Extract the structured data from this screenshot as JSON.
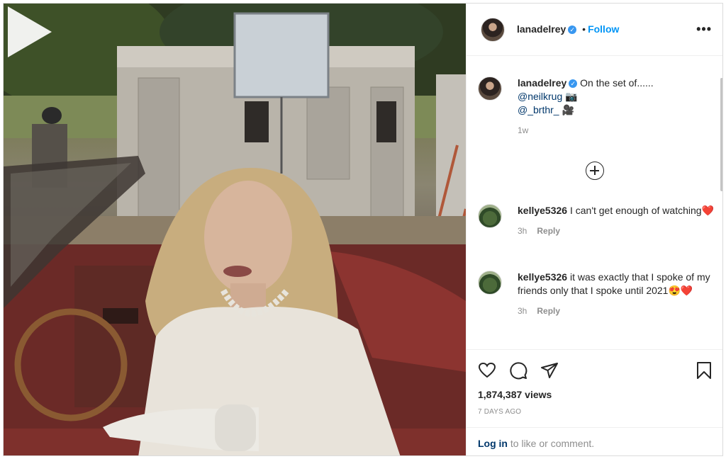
{
  "post": {
    "username": "lanadelrey",
    "verified_mark": "✓",
    "dot": "•",
    "follow_label": "Follow",
    "more_label": "•••"
  },
  "caption": {
    "username": "lanadelrey",
    "text": "On the set of......",
    "mention_1": "@neilkrug",
    "mention_1_emoji": "📷",
    "mention_2": "@_brthr_",
    "mention_2_emoji": "🎥",
    "time": "1w"
  },
  "comments": [
    {
      "username": "kellye5326",
      "text": "I can't get enough of watching",
      "emoji": "❤️",
      "time": "3h",
      "reply_label": "Reply"
    },
    {
      "username": "kellye5326",
      "text": "it was exactly that I spoke of my friends only that I spoke until 2021",
      "emoji": "😍❤️",
      "time": "3h",
      "reply_label": "Reply"
    }
  ],
  "stats": {
    "views": "1,874,387 views",
    "posted": "7 DAYS AGO"
  },
  "login": {
    "link": "Log in",
    "text": " to like or comment."
  },
  "icons": [
    "play-icon",
    "more-icon",
    "plus-circle-icon",
    "heart-icon",
    "comment-icon",
    "share-icon",
    "bookmark-icon"
  ],
  "colors": {
    "link_blue": "#0095f6",
    "mention_blue": "#00376b",
    "secondary_text": "#8e8e8e",
    "heart_red": "#ed4956"
  }
}
